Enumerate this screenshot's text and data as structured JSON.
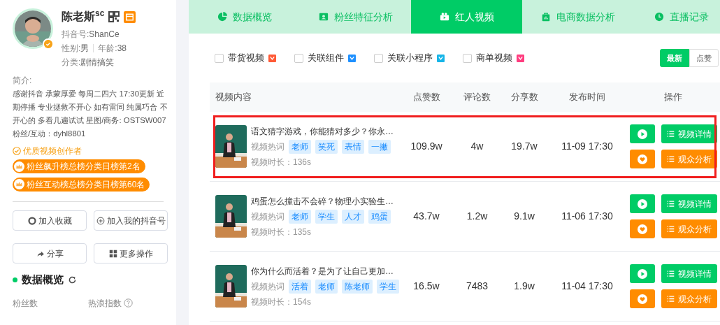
{
  "profile": {
    "name": "陈老斯$^{sc}$",
    "verified": true,
    "fields": [
      {
        "label": "抖音号:",
        "value": "ShanCe"
      },
      {
        "label": "性别:",
        "value": "男"
      },
      {
        "label": "年龄:",
        "value": "38"
      },
      {
        "label": "分类:",
        "value": "剧情搞笑"
      }
    ],
    "bio_label": "简介:",
    "bio": "感谢抖音 承蒙厚爱 每周二四六 17:30更新 近期停播 专业拯救不开心 如有雷同 纯属巧合 不开心的 多看几遍试试 星图/商务: OSTSW007 粉丝/互动：dyhl8801",
    "quality_tag": "优质视频创作者",
    "rank_badges": [
      "粉丝飙升榜总榜分类日榜第2名",
      "粉丝互动榜总榜分类日榜第60名"
    ],
    "actions": [
      {
        "kind": "favorite",
        "label": "加入收藏"
      },
      {
        "kind": "add",
        "label": "加入我的抖音号"
      },
      {
        "kind": "share",
        "label": "分享"
      },
      {
        "kind": "more",
        "label": "更多操作"
      }
    ],
    "overview_title": "数据概览",
    "stats": [
      {
        "label": "粉丝数",
        "help": false
      },
      {
        "label": "热浪指数",
        "help": true
      }
    ]
  },
  "tabs": [
    {
      "kind": "pie",
      "label": "数据概览",
      "selected": false
    },
    {
      "kind": "fans",
      "label": "粉丝特征分析",
      "selected": false
    },
    {
      "kind": "video",
      "label": "红人视频",
      "selected": true
    },
    {
      "kind": "shop",
      "label": "电商数据分析",
      "selected": false
    },
    {
      "kind": "clock",
      "label": "直播记录",
      "selected": false
    }
  ],
  "filters": [
    {
      "label": "带货视频",
      "checked": false,
      "color": "#ff5a36"
    },
    {
      "label": "关联组件",
      "checked": false,
      "color": "#1e90ff"
    },
    {
      "label": "关联小程序",
      "checked": false,
      "color": "#16b5e8"
    },
    {
      "label": "商单视频",
      "checked": false,
      "color": "#ff3d7f"
    }
  ],
  "sort": [
    {
      "label": "最新",
      "selected": true
    },
    {
      "label": "点赞",
      "selected": false
    }
  ],
  "table": {
    "columns": [
      "视频内容",
      "点赞数",
      "评论数",
      "分享数",
      "发布时间",
      "操作"
    ],
    "rows": [
      {
        "title": "语文猜字游戏，你能猜对多少？你永…",
        "hot_label": "视频热词",
        "tags": [
          "老师",
          "笑死",
          "表情",
          "一撇"
        ],
        "duration": "视频时长：136s",
        "likes": "109.9w",
        "comments": "4w",
        "shares": "19.7w",
        "time": "11-09 17:30",
        "highlighted": true,
        "detail": "视频详情",
        "audience": "观众分析"
      },
      {
        "title": "鸡蛋怎么撞击不会碎？物理小实验生…",
        "hot_label": "视频热词",
        "tags": [
          "老师",
          "学生",
          "人才",
          "鸡蛋"
        ],
        "duration": "视频时长：135s",
        "likes": "43.7w",
        "comments": "1.2w",
        "shares": "9.1w",
        "time": "11-06 17:30",
        "highlighted": false,
        "detail": "视频详情",
        "audience": "观众分析"
      },
      {
        "title": "你为什么而活着？是为了让自己更加…",
        "hot_label": "视频热词",
        "tags": [
          "活着",
          "老师",
          "陈老师",
          "学生"
        ],
        "duration": "视频时长：154s",
        "likes": "16.5w",
        "comments": "7483",
        "shares": "1.9w",
        "time": "11-04 17:30",
        "highlighted": false,
        "detail": "视频详情",
        "audience": "观众分析"
      }
    ]
  }
}
